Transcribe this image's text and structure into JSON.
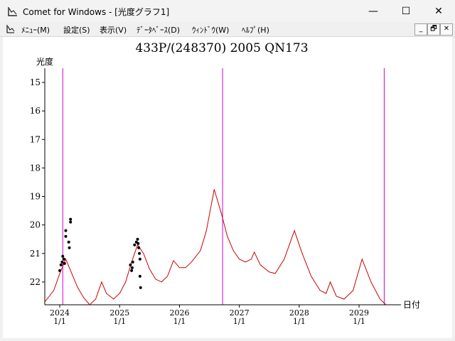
{
  "window": {
    "title": "Comet for Windows - [光度グラフ1]",
    "minimize_glyph": "—",
    "maximize_glyph": "☐",
    "close_glyph": "✕"
  },
  "menu": {
    "items": [
      {
        "label": "ﾒﾆｭｰ(M)"
      },
      {
        "label": "設定(S)"
      },
      {
        "label": "表示(V)"
      },
      {
        "label": "ﾃﾞｰﾀﾍﾞｰｽ(D)"
      },
      {
        "label": "ｳｨﾝﾄﾞｳ(W)"
      },
      {
        "label": "ﾍﾙﾌﾟ(H)"
      }
    ],
    "mdi_minimize": "_",
    "mdi_restore": "🗗",
    "mdi_close": "✕"
  },
  "chart_data": {
    "type": "line",
    "title": "433P/(248370) 2005 QN173",
    "ylabel": "光度",
    "xlabel": "日付",
    "y_inverted": true,
    "ylim": [
      22.8,
      14.5
    ],
    "xlim": [
      2023.75,
      2029.7
    ],
    "y_ticks": [
      15,
      16,
      17,
      18,
      19,
      20,
      21,
      22
    ],
    "x_ticks": [
      {
        "x": 2024,
        "label": "2024",
        "sub": "1/1"
      },
      {
        "x": 2025,
        "label": "2025",
        "sub": "1/1"
      },
      {
        "x": 2026,
        "label": "2026",
        "sub": "1/1"
      },
      {
        "x": 2027,
        "label": "2027",
        "sub": "1/1"
      },
      {
        "x": 2028,
        "label": "2028",
        "sub": "1/1"
      },
      {
        "x": 2029,
        "label": "2029",
        "sub": "1/1"
      }
    ],
    "vertical_lines": [
      2024.05,
      2026.72,
      2029.42
    ],
    "colors": {
      "curve": "#cc0000",
      "vline": "#cc00cc",
      "points": "#000000",
      "axis": "#000000"
    },
    "series": [
      {
        "values": [
          [
            2023.75,
            22.7
          ],
          [
            2023.9,
            22.3
          ],
          [
            2024.0,
            21.7
          ],
          [
            2024.1,
            21.2
          ],
          [
            2024.2,
            21.7
          ],
          [
            2024.3,
            22.2
          ],
          [
            2024.4,
            22.55
          ],
          [
            2024.5,
            22.8
          ],
          [
            2024.6,
            22.6
          ],
          [
            2024.7,
            22.0
          ],
          [
            2024.78,
            22.4
          ],
          [
            2024.9,
            22.6
          ],
          [
            2025.0,
            22.4
          ],
          [
            2025.1,
            22.0
          ],
          [
            2025.2,
            21.3
          ],
          [
            2025.3,
            20.7
          ],
          [
            2025.4,
            21.0
          ],
          [
            2025.5,
            21.55
          ],
          [
            2025.6,
            21.9
          ],
          [
            2025.7,
            22.0
          ],
          [
            2025.8,
            21.8
          ],
          [
            2025.9,
            21.25
          ],
          [
            2026.0,
            21.5
          ],
          [
            2026.1,
            21.5
          ],
          [
            2026.2,
            21.3
          ],
          [
            2026.35,
            20.9
          ],
          [
            2026.45,
            20.2
          ],
          [
            2026.58,
            18.75
          ],
          [
            2026.7,
            19.6
          ],
          [
            2026.8,
            20.4
          ],
          [
            2026.9,
            20.9
          ],
          [
            2027.0,
            21.2
          ],
          [
            2027.1,
            21.3
          ],
          [
            2027.2,
            21.2
          ],
          [
            2027.25,
            20.95
          ],
          [
            2027.35,
            21.4
          ],
          [
            2027.5,
            21.65
          ],
          [
            2027.6,
            21.7
          ],
          [
            2027.75,
            21.2
          ],
          [
            2027.92,
            20.2
          ],
          [
            2028.05,
            21.0
          ],
          [
            2028.2,
            21.8
          ],
          [
            2028.35,
            22.3
          ],
          [
            2028.45,
            22.4
          ],
          [
            2028.52,
            22.0
          ],
          [
            2028.62,
            22.5
          ],
          [
            2028.75,
            22.6
          ],
          [
            2028.9,
            22.3
          ],
          [
            2029.05,
            21.2
          ],
          [
            2029.2,
            22.0
          ],
          [
            2029.35,
            22.6
          ],
          [
            2029.45,
            22.8
          ]
        ]
      },
      {
        "type": "scatter",
        "values": [
          [
            2024.0,
            21.6
          ],
          [
            2024.02,
            21.4
          ],
          [
            2024.04,
            21.3
          ],
          [
            2024.05,
            21.1
          ],
          [
            2024.07,
            21.2
          ],
          [
            2024.08,
            21.35
          ],
          [
            2024.1,
            20.2
          ],
          [
            2024.1,
            20.4
          ],
          [
            2024.15,
            20.6
          ],
          [
            2024.16,
            20.8
          ],
          [
            2024.18,
            19.9
          ],
          [
            2024.18,
            19.8
          ],
          [
            2025.18,
            21.4
          ],
          [
            2025.2,
            21.6
          ],
          [
            2025.21,
            21.5
          ],
          [
            2025.22,
            21.3
          ],
          [
            2025.25,
            20.7
          ],
          [
            2025.28,
            20.6
          ],
          [
            2025.3,
            20.5
          ],
          [
            2025.31,
            20.65
          ],
          [
            2025.32,
            20.8
          ],
          [
            2025.33,
            21.0
          ],
          [
            2025.34,
            21.2
          ],
          [
            2025.34,
            21.8
          ],
          [
            2025.35,
            22.2
          ]
        ]
      }
    ]
  }
}
